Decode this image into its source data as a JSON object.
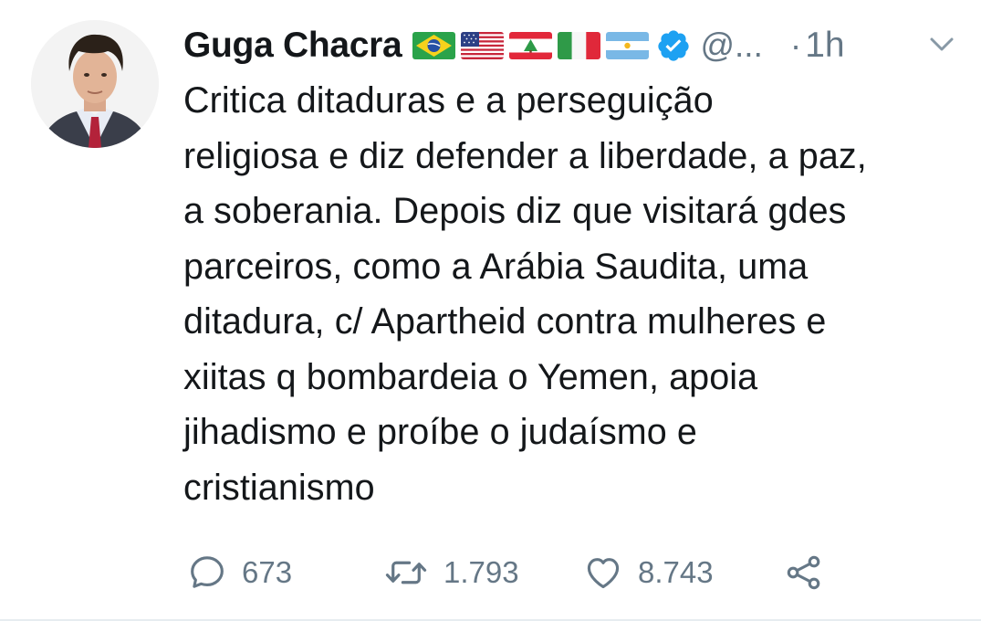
{
  "user": {
    "display_name": "Guga Chacra",
    "handle": "@...",
    "verified": true,
    "flags": [
      "brazil-flag",
      "usa-flag",
      "lebanon-flag",
      "italy-flag",
      "argentina-flag"
    ]
  },
  "meta": {
    "separator": "·",
    "time": "1h"
  },
  "tweet": {
    "text": "Critica ditaduras e a perseguição\nreligiosa e diz defender a liberdade, a paz,\na soberania. Depois diz que visitará gdes\nparceiros, como a Arábia Saudita, uma\nditadura, c/ Apartheid contra mulheres e\nxiitas q bombardeia o Yemen, apoia\njihadismo e proíbe o judaísmo e\ncristianismo"
  },
  "actions": {
    "replies": "673",
    "retweets": "1.793",
    "likes": "8.743"
  },
  "icons": {
    "menu": "chevron-down-icon",
    "reply": "reply-icon",
    "retweet": "retweet-icon",
    "like": "heart-icon",
    "share": "share-icon"
  },
  "colors": {
    "text": "#14171a",
    "secondary": "#657786",
    "verified": "#1da1f2"
  }
}
